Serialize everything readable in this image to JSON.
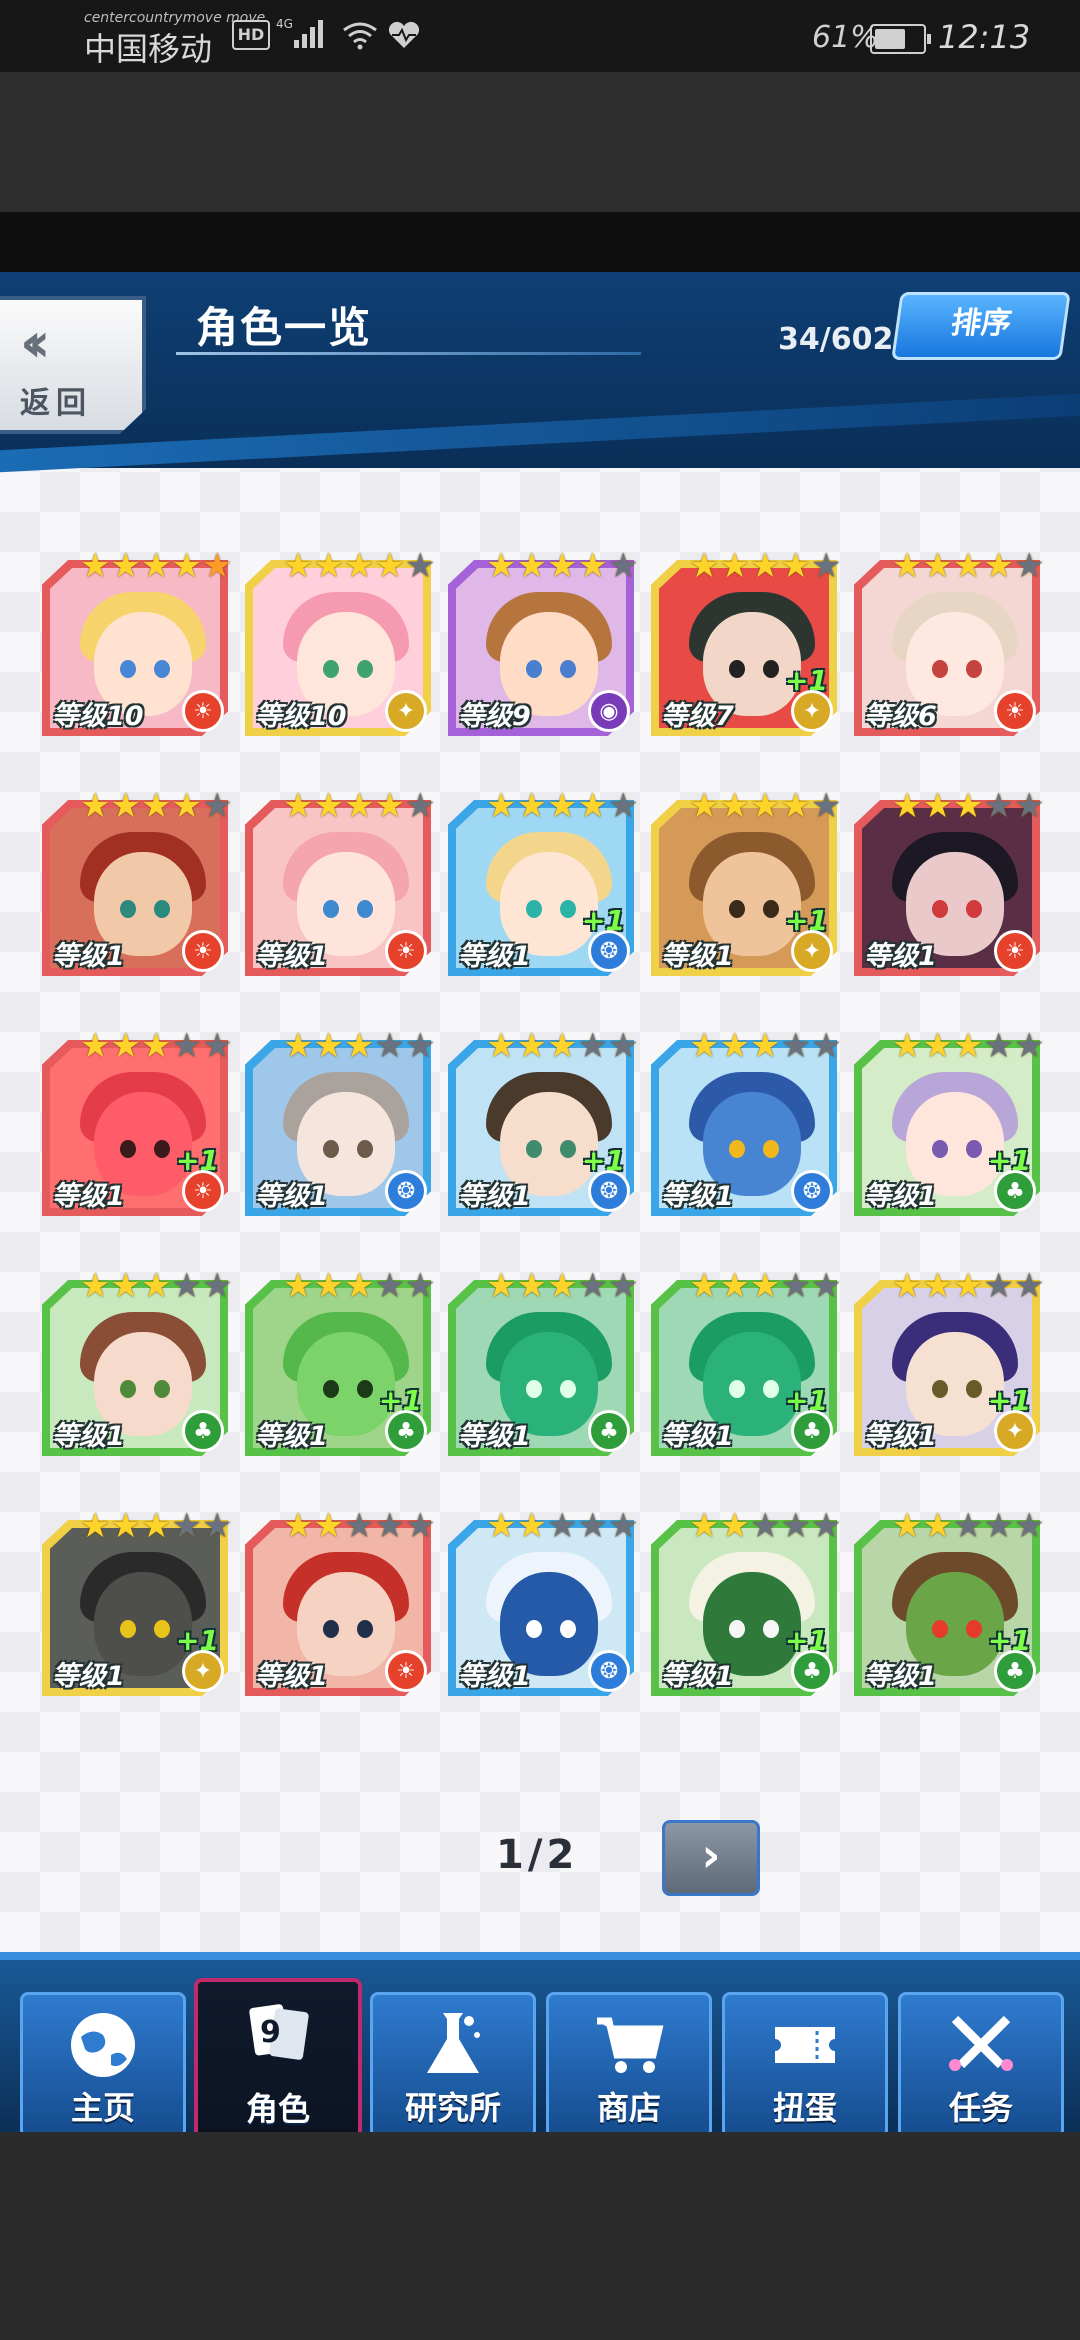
{
  "status_bar": {
    "network_label": "centercountrymove move",
    "carrier": "中国移动",
    "hd_badge": "HD",
    "network_type": "4G",
    "battery_pct": "61%",
    "time": "12:13"
  },
  "header": {
    "back_label": "返回",
    "title": "角色一览",
    "count": "34/602",
    "sort_label": "排序"
  },
  "cards": [
    {
      "level": "等级10",
      "stars": 5,
      "max": 5,
      "plus": "",
      "element": "fire",
      "frame": "#e55b5b",
      "bg": "#f7b9c6",
      "hair": "#f6d46b",
      "skin": "#ffe2cf",
      "eye": "#4a86d6"
    },
    {
      "level": "等级10",
      "stars": 4,
      "max": 5,
      "plus": "",
      "element": "light",
      "frame": "#f0d046",
      "bg": "#ffd0dc",
      "hair": "#f59ab1",
      "skin": "#ffe6da",
      "eye": "#3fa36d"
    },
    {
      "level": "等级9",
      "stars": 4,
      "max": 5,
      "plus": "",
      "element": "dark",
      "frame": "#a561d8",
      "bg": "#e0b8e8",
      "hair": "#b7753e",
      "skin": "#ffdcc6",
      "eye": "#4a7fd0"
    },
    {
      "level": "等级7",
      "stars": 4,
      "max": 5,
      "plus": "+1",
      "element": "light",
      "frame": "#f0d046",
      "bg": "#e84b45",
      "hair": "#2d3530",
      "skin": "#f2d7c8",
      "eye": "#222"
    },
    {
      "level": "等级6",
      "stars": 4,
      "max": 5,
      "plus": "",
      "element": "fire",
      "frame": "#e55b5b",
      "bg": "#f4d7d2",
      "hair": "#e8d6c4",
      "skin": "#ffe8e0",
      "eye": "#c4433e"
    },
    {
      "level": "等级1",
      "stars": 4,
      "max": 5,
      "plus": "",
      "element": "fire",
      "frame": "#e55b5b",
      "bg": "#d86f5a",
      "hair": "#a12f22",
      "skin": "#f1c8a8",
      "eye": "#2b8a7d"
    },
    {
      "level": "等级1",
      "stars": 4,
      "max": 5,
      "plus": "",
      "element": "fire",
      "frame": "#e55b5b",
      "bg": "#f8c4c4",
      "hair": "#f4a5ae",
      "skin": "#ffe4dc",
      "eye": "#3d88cf"
    },
    {
      "level": "等级1",
      "stars": 4,
      "max": 5,
      "plus": "+1",
      "element": "water",
      "frame": "#3aa6e8",
      "bg": "#9ed8f2",
      "hair": "#f3d68c",
      "skin": "#ffe6d4",
      "eye": "#2cb3a8"
    },
    {
      "level": "等级1",
      "stars": 4,
      "max": 5,
      "plus": "+1",
      "element": "light",
      "frame": "#f0d046",
      "bg": "#d59a58",
      "hair": "#8c5a2d",
      "skin": "#f0c49a",
      "eye": "#3a2a1a"
    },
    {
      "level": "等级1",
      "stars": 3,
      "max": 5,
      "plus": "",
      "element": "fire",
      "frame": "#e55b5b",
      "bg": "#5a2e44",
      "hair": "#1c1824",
      "skin": "#e9c9c9",
      "eye": "#d23b3b"
    },
    {
      "level": "等级1",
      "stars": 3,
      "max": 5,
      "plus": "+1",
      "element": "fire",
      "frame": "#e55b5b",
      "bg": "#ff6f6f",
      "hair": "#e53c4a",
      "skin": "#ff5c6a",
      "eye": "#3a1a1a"
    },
    {
      "level": "等级1",
      "stars": 3,
      "max": 5,
      "plus": "",
      "element": "water",
      "frame": "#3aa6e8",
      "bg": "#9ec7ea",
      "hair": "#aaa29d",
      "skin": "#f5e5dc",
      "eye": "#6e5a4a"
    },
    {
      "level": "等级1",
      "stars": 3,
      "max": 5,
      "plus": "+1",
      "element": "water",
      "frame": "#3aa6e8",
      "bg": "#bfe2f5",
      "hair": "#4a3a2c",
      "skin": "#f7ddcc",
      "eye": "#3e8c6c"
    },
    {
      "level": "等级1",
      "stars": 3,
      "max": 5,
      "plus": "",
      "element": "water",
      "frame": "#3aa6e8",
      "bg": "#b9e2f7",
      "hair": "#2c5aa8",
      "skin": "#4785d2",
      "eye": "#f1b81c"
    },
    {
      "level": "等级1",
      "stars": 3,
      "max": 5,
      "plus": "+1",
      "element": "wood",
      "frame": "#58c248",
      "bg": "#d4ecc8",
      "hair": "#b8a6d8",
      "skin": "#ffe6dc",
      "eye": "#7a5ab0"
    },
    {
      "level": "等级1",
      "stars": 3,
      "max": 5,
      "plus": "",
      "element": "wood",
      "frame": "#58c248",
      "bg": "#c8e9bd",
      "hair": "#8a4d35",
      "skin": "#f6dacb",
      "eye": "#4f8a3a"
    },
    {
      "level": "等级1",
      "stars": 3,
      "max": 5,
      "plus": "+1",
      "element": "wood",
      "frame": "#58c248",
      "bg": "#9fd58b",
      "hair": "#55b84a",
      "skin": "#7cd36a",
      "eye": "#1c3a18"
    },
    {
      "level": "等级1",
      "stars": 3,
      "max": 5,
      "plus": "",
      "element": "wood",
      "frame": "#58c248",
      "bg": "#9fd8b5",
      "hair": "#1b9c63",
      "skin": "#2bb17a",
      "eye": "#dfffe8"
    },
    {
      "level": "等级1",
      "stars": 3,
      "max": 5,
      "plus": "+1",
      "element": "wood",
      "frame": "#58c248",
      "bg": "#9fd8b5",
      "hair": "#1b9c63",
      "skin": "#2bb17a",
      "eye": "#dfffe8"
    },
    {
      "level": "等级1",
      "stars": 3,
      "max": 5,
      "plus": "+1",
      "element": "light",
      "frame": "#f0d046",
      "bg": "#d8d0e6",
      "hair": "#3a2e7a",
      "skin": "#f6e0d2",
      "eye": "#6a5a2a"
    },
    {
      "level": "等级1",
      "stars": 3,
      "max": 5,
      "plus": "+1",
      "element": "light",
      "frame": "#f0d046",
      "bg": "#5b5e58",
      "hair": "#2a2a2a",
      "skin": "#4e4e4a",
      "eye": "#e8c41a"
    },
    {
      "level": "等级1",
      "stars": 2,
      "max": 5,
      "plus": "",
      "element": "fire",
      "frame": "#e55b5b",
      "bg": "#f2b6a8",
      "hair": "#c53128",
      "skin": "#f6d2c2",
      "eye": "#20304a"
    },
    {
      "level": "等级1",
      "stars": 2,
      "max": 5,
      "plus": "",
      "element": "water",
      "frame": "#3aa6e8",
      "bg": "#cfe8f6",
      "hair": "#eef4fb",
      "skin": "#245aa8",
      "eye": "#ffffff"
    },
    {
      "level": "等级1",
      "stars": 2,
      "max": 5,
      "plus": "+1",
      "element": "wood",
      "frame": "#58c248",
      "bg": "#c9e8c0",
      "hair": "#f4f2e2",
      "skin": "#2f7a3a",
      "eye": "#f6f6f6"
    },
    {
      "level": "等级1",
      "stars": 2,
      "max": 5,
      "plus": "+1",
      "element": "wood",
      "frame": "#58c248",
      "bg": "#b9d6a8",
      "hair": "#6d4a2a",
      "skin": "#6aa648",
      "eye": "#e63a2a"
    }
  ],
  "element_colors": {
    "fire": "#e6412b",
    "light": "#d7a925",
    "dark": "#7a3bb8",
    "water": "#2f7ddb",
    "wood": "#2f9e3a"
  },
  "pagination": {
    "indicator": "1/2",
    "next_glyph": "›"
  },
  "nav": [
    {
      "label": "主页",
      "icon": "globe-icon"
    },
    {
      "label": "角色",
      "icon": "cards-icon",
      "active": true
    },
    {
      "label": "研究所",
      "icon": "flask-icon"
    },
    {
      "label": "商店",
      "icon": "cart-icon"
    },
    {
      "label": "扭蛋",
      "icon": "ticket-icon"
    },
    {
      "label": "任务",
      "icon": "swords-icon"
    }
  ]
}
